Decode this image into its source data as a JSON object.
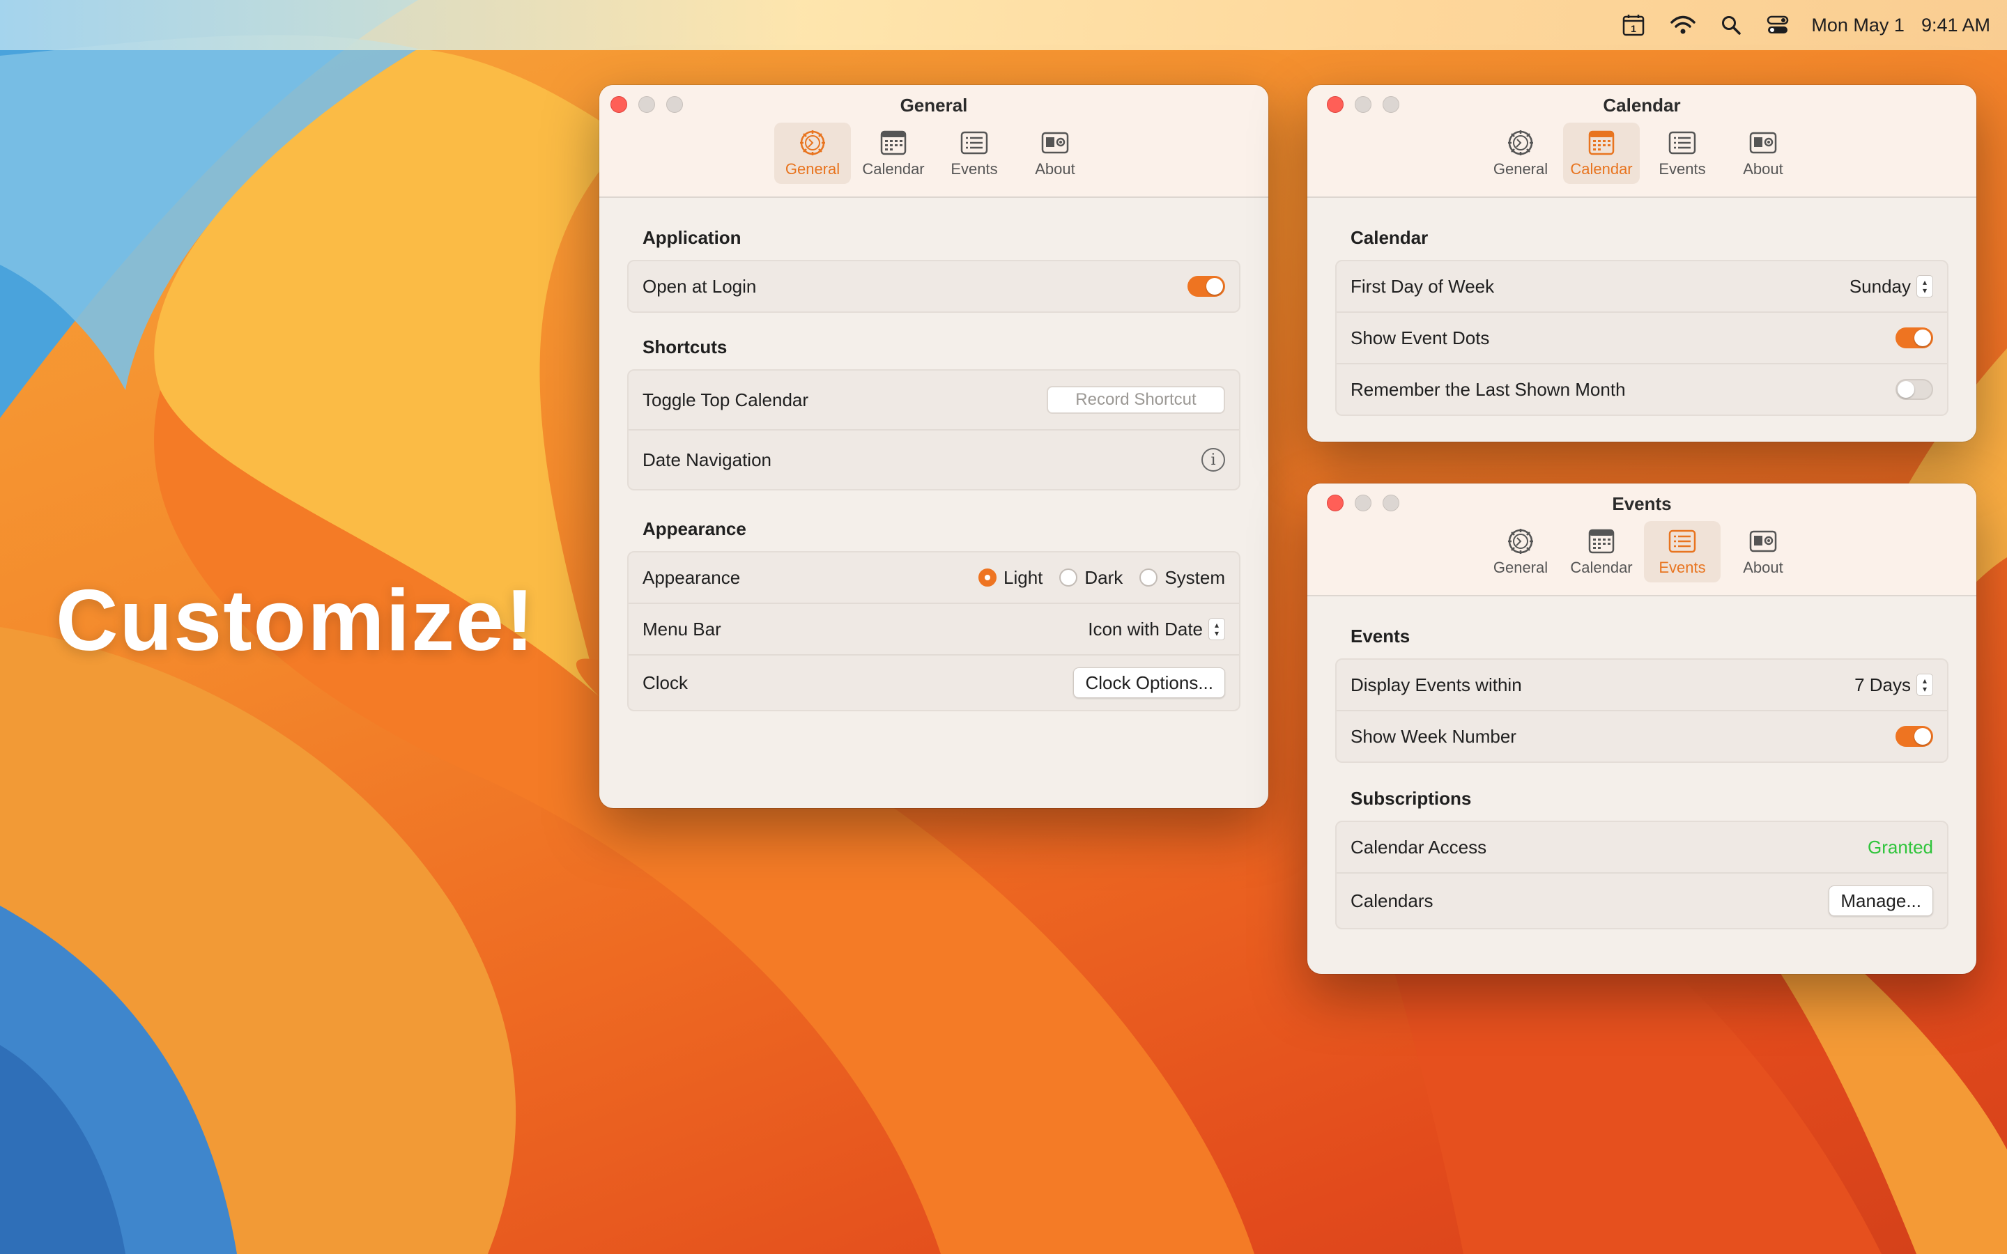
{
  "menubar": {
    "date": "Mon May 1",
    "time": "9:41 AM",
    "calendar_icon_day": "1"
  },
  "headline": "Customize!",
  "colors": {
    "accent": "#ee7421",
    "granted": "#2ec43a",
    "close_light": "#ff5f57"
  },
  "icons": {
    "general": "gear-icon",
    "calendar": "calendar-icon",
    "events": "list-icon",
    "about": "contact-card-icon"
  },
  "tabs": {
    "general": "General",
    "calendar": "Calendar",
    "events": "Events",
    "about": "About"
  },
  "general_window": {
    "title": "General",
    "active_tab": "General",
    "application": {
      "heading": "Application",
      "open_at_login": "Open at Login",
      "open_at_login_on": true
    },
    "shortcuts": {
      "heading": "Shortcuts",
      "toggle_top_calendar": "Toggle Top Calendar",
      "record_shortcut": "Record Shortcut",
      "date_navigation": "Date Navigation"
    },
    "appearance": {
      "heading": "Appearance",
      "appearance_label": "Appearance",
      "options": [
        "Light",
        "Dark",
        "System"
      ],
      "selected": "Light",
      "menu_bar_label": "Menu Bar",
      "menu_bar_value": "Icon with Date",
      "clock_label": "Clock",
      "clock_button": "Clock Options..."
    }
  },
  "calendar_window": {
    "title": "Calendar",
    "active_tab": "Calendar",
    "heading": "Calendar",
    "first_day_label": "First Day of Week",
    "first_day_value": "Sunday",
    "show_event_dots": "Show Event Dots",
    "show_event_dots_on": true,
    "remember_month": "Remember the Last Shown Month",
    "remember_month_on": false
  },
  "events_window": {
    "title": "Events",
    "active_tab": "Events",
    "heading": "Events",
    "display_within_label": "Display Events within",
    "display_within_value": "7 Days",
    "show_week_number": "Show Week Number",
    "show_week_number_on": true,
    "subscriptions_heading": "Subscriptions",
    "calendar_access_label": "Calendar Access",
    "calendar_access_value": "Granted",
    "calendars_label": "Calendars",
    "manage_button": "Manage..."
  }
}
